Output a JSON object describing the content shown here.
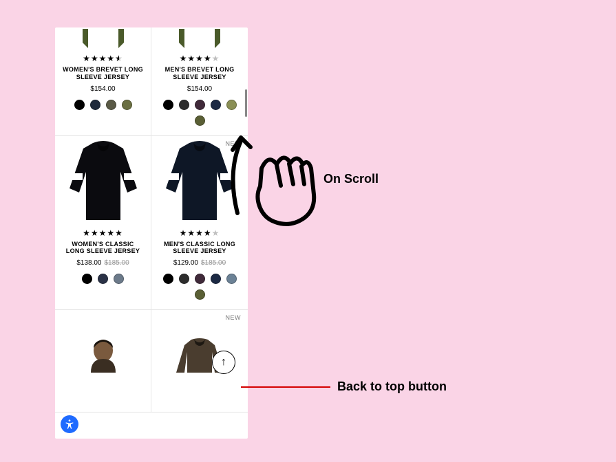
{
  "annotations": {
    "on_scroll": "On Scroll",
    "back_to_top": "Back to top button"
  },
  "back_to_top_glyph": "↑",
  "products": [
    {
      "name": "WOMEN'S BREVET LONG SLEEVE JERSEY",
      "stars_display": "★★★★⯪",
      "rating": 4.5,
      "price": "$154.00",
      "strike": "",
      "new": false,
      "jersey_color": "#4a5a2a",
      "swatches": [
        "#000000",
        "#1f2a3b",
        "#5a5a46",
        "#6a6f42"
      ],
      "partial": "top"
    },
    {
      "name": "MEN'S BREVET LONG SLEEVE JERSEY",
      "stars_display": "★★★★☆",
      "rating": 4,
      "price": "$154.00",
      "strike": "",
      "new": false,
      "jersey_color": "#4a5a2a",
      "swatches": [
        "#000000",
        "#2d2d2d",
        "#402a3a",
        "#1c2944",
        "#8a8f55",
        "#5a5f35"
      ],
      "partial": "top"
    },
    {
      "name": "WOMEN'S CLASSIC LONG SLEEVE JERSEY",
      "stars_display": "★★★★★",
      "rating": 5,
      "price": "$138.00",
      "strike": "$185.00",
      "new": false,
      "jersey_color": "#0b0b0f",
      "swatches": [
        "#000000",
        "#2a3246",
        "#6c7a8a"
      ],
      "partial": ""
    },
    {
      "name": "MEN'S CLASSIC LONG SLEEVE JERSEY",
      "stars_display": "★★★★☆",
      "rating": 4,
      "price": "$129.00",
      "strike": "$185.00",
      "new": true,
      "jersey_color": "#0e1726",
      "swatches": [
        "#000000",
        "#2d2d2d",
        "#402a3a",
        "#1c2944",
        "#6c8296",
        "#5a5f35"
      ],
      "partial": ""
    },
    {
      "name": "",
      "stars_display": "",
      "rating": 0,
      "price": "",
      "strike": "",
      "new": false,
      "jersey_color": "person",
      "swatches": [],
      "partial": "bottom"
    },
    {
      "name": "",
      "stars_display": "",
      "rating": 0,
      "price": "",
      "strike": "",
      "new": true,
      "jersey_color": "#4a3d2f",
      "swatches": [],
      "partial": "bottom"
    }
  ],
  "new_tag": "NEW"
}
